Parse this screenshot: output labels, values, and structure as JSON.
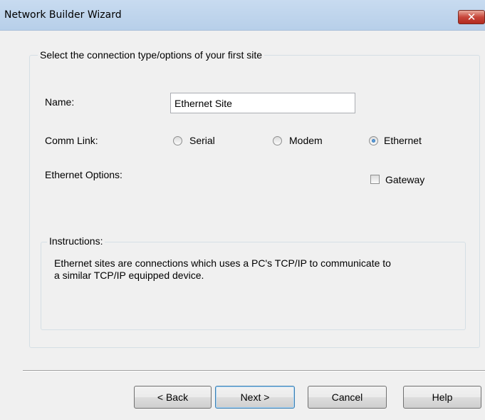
{
  "window": {
    "title": "Network Builder Wizard",
    "close_glyph": "✕"
  },
  "group": {
    "legend": "Select the connection type/options of your first site",
    "name_label": "Name:",
    "name_value": "Ethernet Site",
    "comm_link_label": "Comm Link:",
    "comm_link_options": [
      {
        "label": "Serial",
        "checked": false
      },
      {
        "label": "Modem",
        "checked": false
      },
      {
        "label": "Ethernet",
        "checked": true
      }
    ],
    "ethernet_options_label": "Ethernet Options:",
    "gateway_label": "Gateway",
    "gateway_checked": false
  },
  "instructions": {
    "legend": "Instructions:",
    "line1": "Ethernet sites are connections which uses a PC's TCP/IP to communicate to",
    "line2": "a similar TCP/IP equipped device."
  },
  "buttons": {
    "back": "< Back",
    "next": "Next >",
    "cancel": "Cancel",
    "help": "Help"
  },
  "icons": {
    "close": "close-icon",
    "radio": "radio-button",
    "checkbox": "checkbox"
  },
  "colors": {
    "titlebar": "#c8dbf0",
    "close_button": "#c7463a",
    "dialog_bg": "#f0f0f0"
  }
}
